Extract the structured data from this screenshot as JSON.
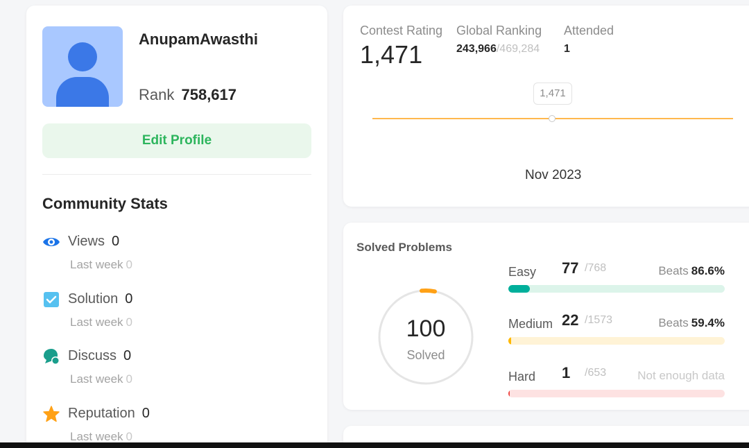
{
  "colors": {
    "accent_green": "#2db55d",
    "easy": "#00af9b",
    "easy_track": "#dcf4ea",
    "medium": "#ffb800",
    "medium_track": "#fff3d6",
    "hard": "#ef4743",
    "hard_track": "#fde2e2",
    "rating_line": "#ffb84d"
  },
  "profile": {
    "username": "AnupamAwasthi",
    "rank_label": "Rank",
    "rank_value": "758,617",
    "edit_label": "Edit Profile",
    "avatar_icon": "user-avatar-icon"
  },
  "community": {
    "title": "Community Stats",
    "last_week_label": "Last week",
    "items": [
      {
        "label": "Views",
        "value": "0",
        "last_week": "0",
        "icon": "eye-icon"
      },
      {
        "label": "Solution",
        "value": "0",
        "last_week": "0",
        "icon": "checkbox-icon"
      },
      {
        "label": "Discuss",
        "value": "0",
        "last_week": "0",
        "icon": "chat-icon"
      },
      {
        "label": "Reputation",
        "value": "0",
        "last_week": "0",
        "icon": "star-icon"
      }
    ]
  },
  "contest": {
    "rating_label": "Contest Rating",
    "rating_value": "1,471",
    "global_label": "Global Ranking",
    "global_value": "243,966",
    "global_total": "/469,284",
    "attended_label": "Attended",
    "attended_value": "1",
    "tooltip_value": "1,471",
    "month_label": "Nov 2023"
  },
  "solved": {
    "title": "Solved Problems",
    "total": "100",
    "total_label": "Solved",
    "beats_label": "Beats",
    "difficulties": [
      {
        "name": "Easy",
        "count": "77",
        "total": "/768",
        "beats": "86.6%",
        "progress": 0.1
      },
      {
        "name": "Medium",
        "count": "22",
        "total": "/1573",
        "beats": "59.4%",
        "progress": 0.014
      },
      {
        "name": "Hard",
        "count": "1",
        "total": "/653",
        "note": "Not enough data",
        "progress": 0.0015
      }
    ]
  }
}
